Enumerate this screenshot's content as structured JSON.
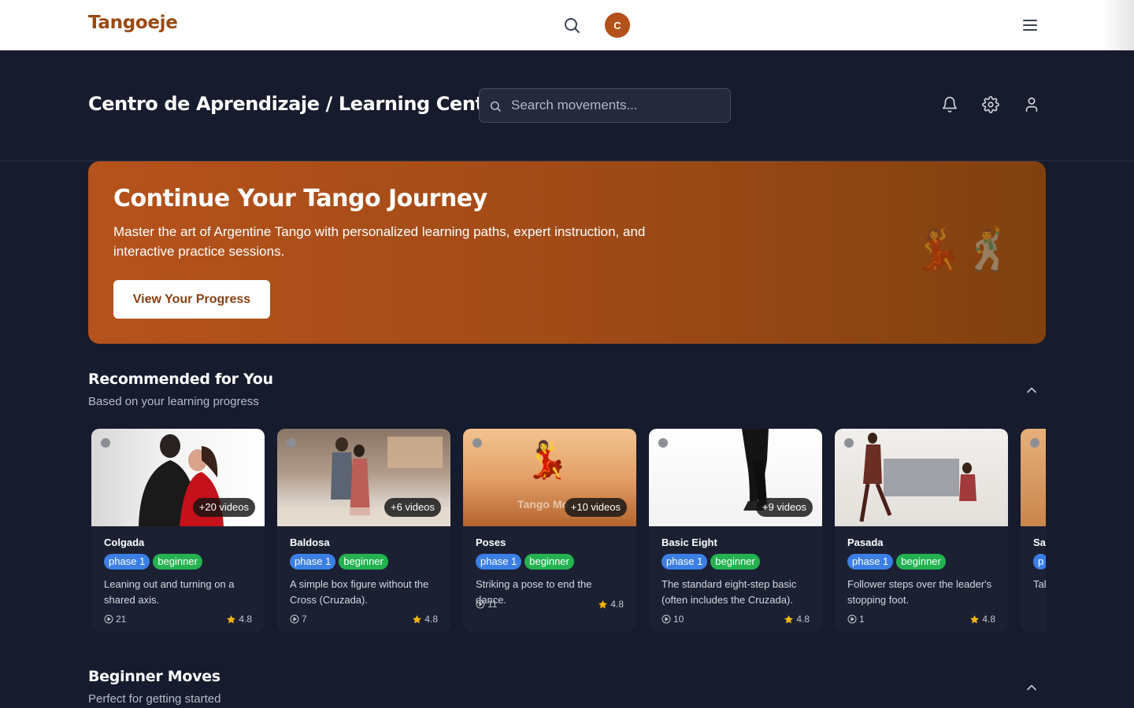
{
  "topbar": {
    "logo": "Tangoeje",
    "avatar_initial": "C"
  },
  "header": {
    "title": "Centro de Aprendizaje / Learning Center",
    "search_placeholder": "Search movements..."
  },
  "hero": {
    "title": "Continue Your Tango Journey",
    "description": "Master the art of Argentine Tango with personalized learning paths, expert instruction, and interactive practice sessions.",
    "button": "View Your Progress",
    "decoration": "💃🕺"
  },
  "sections": [
    {
      "title": "Recommended for You",
      "subtitle": "Based on your learning progress"
    },
    {
      "title": "Beginner Moves",
      "subtitle": "Perfect for getting started"
    }
  ],
  "cards": [
    {
      "name": "Colgada",
      "videos": "+20 videos",
      "phase": "phase 1",
      "level": "beginner",
      "desc": "Leaning out and turning on a shared axis.",
      "count": "21",
      "rating": "4.8",
      "overlay": ""
    },
    {
      "name": "Baldosa",
      "videos": "+6 videos",
      "phase": "phase 1",
      "level": "beginner",
      "desc": "A simple box figure without the Cross (Cruzada).",
      "count": "7",
      "rating": "4.8",
      "overlay": ""
    },
    {
      "name": "Poses",
      "videos": "+10 videos",
      "phase": "phase 1",
      "level": "beginner",
      "desc": "Striking a pose to end the dance.",
      "count": "11",
      "rating": "4.8",
      "overlay": "Tango Mo"
    },
    {
      "name": "Basic Eight",
      "videos": "+9 videos",
      "phase": "phase 1",
      "level": "beginner",
      "desc": "The standard eight-step basic (often includes the Cruzada).",
      "count": "10",
      "rating": "4.8",
      "overlay": ""
    },
    {
      "name": "Pasada",
      "videos": "",
      "phase": "phase 1",
      "level": "beginner",
      "desc": "Follower steps over the leader's stopping foot.",
      "count": "1",
      "rating": "4.8",
      "overlay": ""
    },
    {
      "name": "Sa",
      "videos": "",
      "phase": "p",
      "level": "",
      "desc": "Tal pa",
      "count": "",
      "rating": "",
      "overlay": ""
    }
  ],
  "colors": {
    "accent": "#b4501a",
    "phase_tag": "#3b7fe6",
    "level_tag": "#23b24f",
    "background": "#161b2e"
  }
}
